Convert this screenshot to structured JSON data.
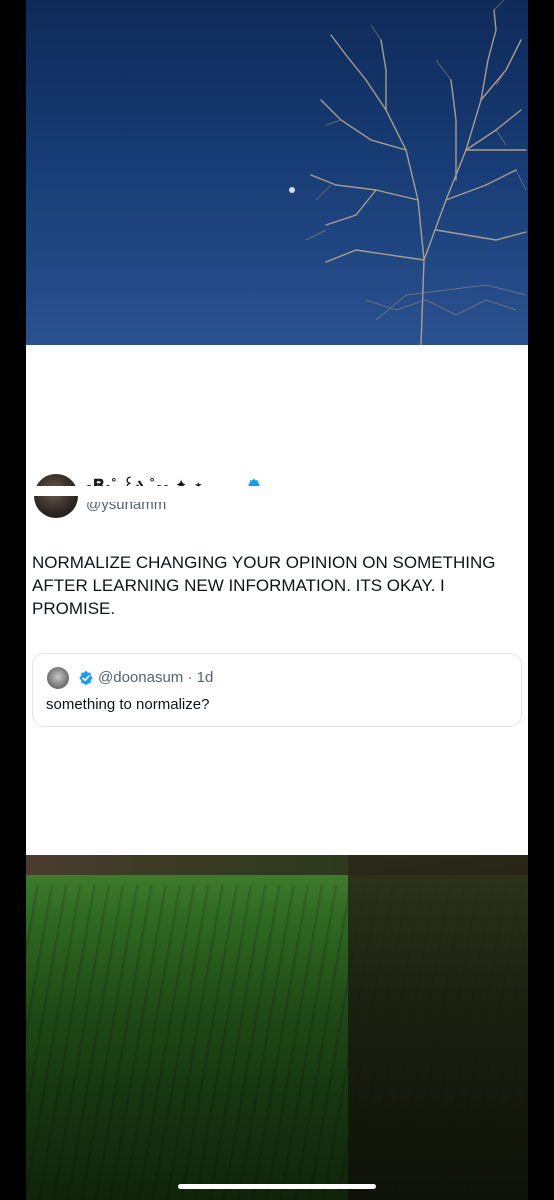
{
  "post": {
    "display_name": "ₒ𝐑ₑ˚ ꒰ა ˚ₒₑ ✦ ⋆",
    "handle": "@ysunamm",
    "text": "NORMALIZE CHANGING YOUR OPINION ON SOMETHING AFTER LEARNING NEW INFORMATION. ITS OKAY. I PROMISE."
  },
  "quoted_post": {
    "handle_time": "@doonasum · 1d",
    "text": "something to normalize?"
  },
  "colors": {
    "verified_blue": "#1d9bf0",
    "text_primary": "#0f1419",
    "text_secondary": "#536471"
  },
  "icons": {
    "verified": "verified-badge-icon"
  }
}
